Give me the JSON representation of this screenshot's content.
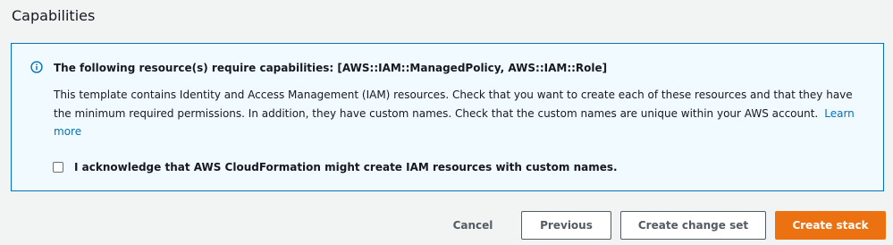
{
  "section": {
    "title": "Capabilities"
  },
  "alert": {
    "icon": "info-icon",
    "header": "The following resource(s) require capabilities: [AWS::IAM::ManagedPolicy, AWS::IAM::Role]",
    "body": "This template contains Identity and Access Management (IAM) resources. Check that you want to create each of these resources and that they have the minimum required permissions. In addition, they have custom names. Check that the custom names are unique within your AWS account.",
    "learn_more": "Learn more",
    "acknowledge_label": "I acknowledge that AWS CloudFormation might create IAM resources with custom names.",
    "acknowledge_checked": false
  },
  "actions": {
    "cancel": "Cancel",
    "previous": "Previous",
    "create_change_set": "Create change set",
    "create_stack": "Create stack"
  },
  "colors": {
    "info_blue": "#0073bb",
    "primary_orange": "#ec7211",
    "alert_background": "#f1faff",
    "page_background": "#f2f3f3"
  }
}
